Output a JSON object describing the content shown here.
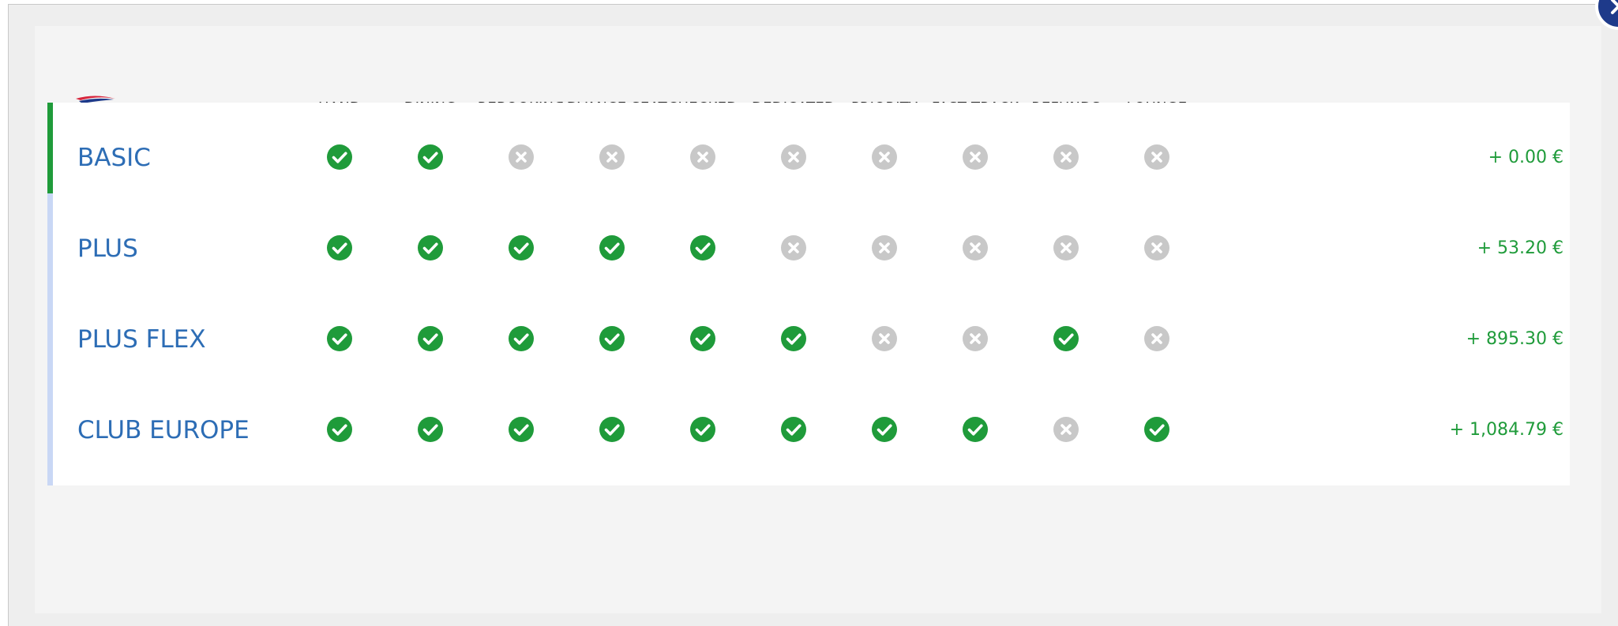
{
  "columns": [
    "HAND BAGGAGE",
    "DINING",
    "REBOOKING",
    "ADVANCE SEAT RESERVATION",
    "CHECKED BAGGAGE",
    "DEDICATED CHECK-IN",
    "PRIORITY BOARDING",
    "FAST TRACK SECURITY",
    "REFUNDS",
    "LOUNGE ACCESS"
  ],
  "column_lines": [
    [
      "HAND BAGGAGE"
    ],
    [
      "DINING"
    ],
    [
      "REBOOKING"
    ],
    [
      "ADVANCE SEAT",
      "RESERVATION"
    ],
    [
      "CHECKED",
      "BAGGAGE"
    ],
    [
      "DEDICATED",
      "CHECK-IN"
    ],
    [
      "PRIORITY",
      "BOARDING"
    ],
    [
      "FAST TRACK",
      "SECURITY"
    ],
    [
      "REFUNDS"
    ],
    [
      "LOUNGE",
      "ACCESS"
    ]
  ],
  "fares": [
    {
      "name": "BASIC",
      "price": "+ 0.00 €",
      "selected": true,
      "features": [
        true,
        true,
        false,
        false,
        false,
        false,
        false,
        false,
        false,
        false
      ]
    },
    {
      "name": "PLUS",
      "price": "+ 53.20 €",
      "selected": false,
      "features": [
        true,
        true,
        true,
        true,
        true,
        false,
        false,
        false,
        false,
        false
      ]
    },
    {
      "name": "PLUS FLEX",
      "price": "+ 895.30 €",
      "selected": false,
      "features": [
        true,
        true,
        true,
        true,
        true,
        true,
        false,
        false,
        true,
        false
      ]
    },
    {
      "name": "CLUB EUROPE",
      "price": "+ 1,084.79 €",
      "selected": false,
      "features": [
        true,
        true,
        true,
        true,
        true,
        true,
        true,
        true,
        false,
        true
      ]
    }
  ],
  "icons": {
    "included": "check-circle-icon",
    "not_included": "cross-circle-icon",
    "logo": "airline-logo-icon",
    "close": "close-icon"
  },
  "colors": {
    "accent_green": "#1f9b3a",
    "fare_name_blue": "#2d6db5",
    "excluded_grey": "#c8c8c8",
    "close_button": "#1e3a8a",
    "unselected_bar": "#c9d7f5"
  }
}
